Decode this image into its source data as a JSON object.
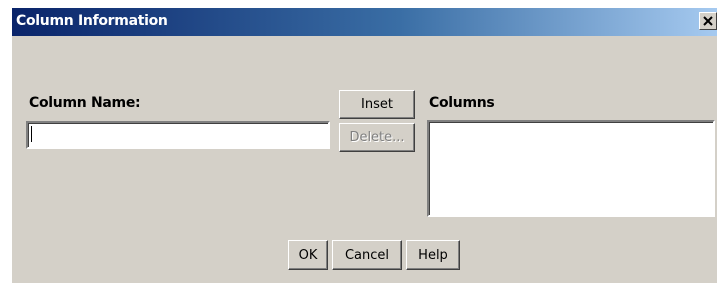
{
  "window": {
    "title": "Column Information",
    "close_label": "Close"
  },
  "form": {
    "column_name_label": "Column Name:",
    "column_name_value": "",
    "columns_label": "Columns",
    "columns_items": []
  },
  "buttons": {
    "insert": "Inset",
    "delete": "Delete...",
    "ok": "OK",
    "cancel": "Cancel",
    "help": "Help"
  },
  "colors": {
    "title_start": "#0a246a",
    "title_end": "#a6caf0",
    "face": "#d4d0c8"
  }
}
